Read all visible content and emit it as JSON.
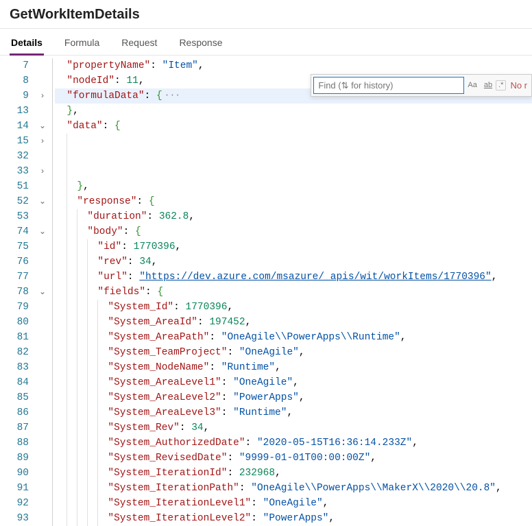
{
  "title": "GetWorkItemDetails",
  "tabs": [
    {
      "label": "Details",
      "active": true
    },
    {
      "label": "Formula"
    },
    {
      "label": "Request"
    },
    {
      "label": "Response"
    }
  ],
  "find": {
    "placeholder": "Find (⇅ for history)",
    "no_results": "No r",
    "case_icon": "Aa",
    "word_icon": "ab",
    "regex_icon": ".*"
  },
  "code": {
    "prop_propertyName": "\"propertyName\"",
    "val_propertyName": "\"Item\"",
    "prop_nodeId": "\"nodeId\"",
    "val_nodeId": "11",
    "prop_formulaData": "\"formulaData\"",
    "prop_data": "\"data\"",
    "prop_response": "\"response\"",
    "prop_duration": "\"duration\"",
    "val_duration": "362.8",
    "prop_body": "\"body\"",
    "prop_id": "\"id\"",
    "val_id": "1770396",
    "prop_rev": "\"rev\"",
    "val_rev": "34",
    "prop_url": "\"url\"",
    "val_url": "\"https://dev.azure.com/msazure/_apis/wit/workItems/1770396\"",
    "prop_fields": "\"fields\"",
    "prop_SystemId": "\"System_Id\"",
    "val_SystemId": "1770396",
    "prop_SystemAreaId": "\"System_AreaId\"",
    "val_SystemAreaId": "197452",
    "prop_SystemAreaPath": "\"System_AreaPath\"",
    "val_SystemAreaPath": "\"OneAgile\\\\PowerApps\\\\Runtime\"",
    "prop_SystemTeamProject": "\"System_TeamProject\"",
    "val_SystemTeamProject": "\"OneAgile\"",
    "prop_SystemNodeName": "\"System_NodeName\"",
    "val_SystemNodeName": "\"Runtime\"",
    "prop_SystemAreaLevel1": "\"System_AreaLevel1\"",
    "val_SystemAreaLevel1": "\"OneAgile\"",
    "prop_SystemAreaLevel2": "\"System_AreaLevel2\"",
    "val_SystemAreaLevel2": "\"PowerApps\"",
    "prop_SystemAreaLevel3": "\"System_AreaLevel3\"",
    "val_SystemAreaLevel3": "\"Runtime\"",
    "prop_SystemRev": "\"System_Rev\"",
    "val_SystemRev": "34",
    "prop_SystemAuthorizedDate": "\"System_AuthorizedDate\"",
    "val_SystemAuthorizedDate": "\"2020-05-15T16:36:14.233Z\"",
    "prop_SystemRevisedDate": "\"System_RevisedDate\"",
    "val_SystemRevisedDate": "\"9999-01-01T00:00:00Z\"",
    "prop_SystemIterationId": "\"System_IterationId\"",
    "val_SystemIterationId": "232968",
    "prop_SystemIterationPath": "\"System_IterationPath\"",
    "val_SystemIterationPath": "\"OneAgile\\\\PowerApps\\\\MakerX\\\\2020\\\\20.8\"",
    "prop_SystemIterationLevel1": "\"System_IterationLevel1\"",
    "val_SystemIterationLevel1": "\"OneAgile\"",
    "prop_SystemIterationLevel2": "\"System_IterationLevel2\"",
    "val_SystemIterationLevel2": "\"PowerApps\""
  },
  "lines": [
    {
      "num": 7
    },
    {
      "num": 8
    },
    {
      "num": 9,
      "fold": ">"
    },
    {
      "num": 13
    },
    {
      "num": 14,
      "fold": "v"
    },
    {
      "num": 15,
      "fold": ">"
    },
    {
      "num": 32
    },
    {
      "num": 33,
      "fold": ">"
    },
    {
      "num": 51
    },
    {
      "num": 52,
      "fold": "v"
    },
    {
      "num": 53
    },
    {
      "num": 74,
      "fold": "v"
    },
    {
      "num": 75
    },
    {
      "num": 76
    },
    {
      "num": 77
    },
    {
      "num": 78,
      "fold": "v"
    },
    {
      "num": 79
    },
    {
      "num": 80
    },
    {
      "num": 81
    },
    {
      "num": 82
    },
    {
      "num": 83
    },
    {
      "num": 84
    },
    {
      "num": 85
    },
    {
      "num": 86
    },
    {
      "num": 87
    },
    {
      "num": 88
    },
    {
      "num": 89
    },
    {
      "num": 90
    },
    {
      "num": 91
    },
    {
      "num": 92
    },
    {
      "num": 93
    }
  ]
}
